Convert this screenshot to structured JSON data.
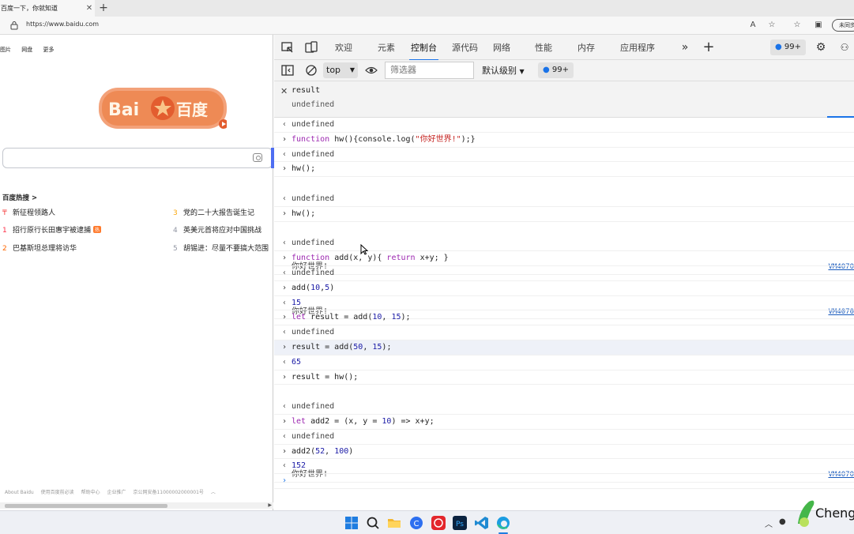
{
  "browser": {
    "tab_title": "百度一下，你就知道",
    "tab_close": "✕",
    "new_tab": "+",
    "url": "https://www.baidu.com",
    "profile": "未同步"
  },
  "baidu": {
    "nav": [
      "图片",
      "网盘",
      "更多"
    ],
    "logo_text": "百度",
    "logo_prefix": "Bai",
    "hot_title": "百度热搜 >",
    "hot_list": [
      {
        "num": "",
        "text": "新征程领路人"
      },
      {
        "num": "1",
        "text": "招行原行长田惠宇被逮捕",
        "badge": "热"
      },
      {
        "num": "2",
        "text": "巴基斯坦总理将访华"
      },
      {
        "num": "3",
        "text": "党的二十大报告诞生记"
      },
      {
        "num": "4",
        "text": "英美元首将应对中国挑战"
      },
      {
        "num": "5",
        "text": "胡锡进：尽量不要搞大范围"
      }
    ],
    "footer": [
      "About Baidu",
      "使用百度前必读",
      "帮助中心",
      "企业推广",
      "京公网安备11000002000001号"
    ]
  },
  "devtools": {
    "tabs": [
      "欢迎",
      "元素",
      "控制台",
      "源代码",
      "网络",
      "性能",
      "内存",
      "应用程序"
    ],
    "active_tab": "控制台",
    "message_count": "99+",
    "context": "top",
    "filter_placeholder": "筛选器",
    "level": "默认级别",
    "live_expression": {
      "expr": "result",
      "value": "undefined"
    },
    "source_link": "VM4070"
  },
  "console": [
    {
      "type": "res",
      "text": "undefined"
    },
    {
      "type": "in",
      "parts": [
        {
          "t": "function",
          "c": "kw"
        },
        {
          "t": " hw(){console.log("
        },
        {
          "t": "\"你好世界!\"",
          "c": "str"
        },
        {
          "t": ");}"
        }
      ]
    },
    {
      "type": "res",
      "text": "undefined"
    },
    {
      "type": "in",
      "text": "hw();"
    },
    {
      "type": "log",
      "text": "你好世界!",
      "src": true
    },
    {
      "type": "res",
      "text": "undefined"
    },
    {
      "type": "in",
      "text": "hw();"
    },
    {
      "type": "log",
      "text": "你好世界!",
      "src": true
    },
    {
      "type": "res",
      "text": "undefined"
    },
    {
      "type": "in",
      "parts": [
        {
          "t": "function",
          "c": "kw"
        },
        {
          "t": " add(x, y){ "
        },
        {
          "t": "return",
          "c": "kw"
        },
        {
          "t": " x+y; }"
        }
      ]
    },
    {
      "type": "res",
      "text": "undefined"
    },
    {
      "type": "in",
      "parts": [
        {
          "t": "add("
        },
        {
          "t": "10",
          "c": "num"
        },
        {
          "t": ","
        },
        {
          "t": "5",
          "c": "num"
        },
        {
          "t": ")"
        }
      ]
    },
    {
      "type": "res",
      "parts": [
        {
          "t": "15",
          "c": "num"
        }
      ]
    },
    {
      "type": "in",
      "parts": [
        {
          "t": "let",
          "c": "kw"
        },
        {
          "t": " result = add("
        },
        {
          "t": "10",
          "c": "num"
        },
        {
          "t": ", "
        },
        {
          "t": "15",
          "c": "num"
        },
        {
          "t": ");"
        }
      ]
    },
    {
      "type": "res",
      "text": "undefined"
    },
    {
      "type": "in",
      "hl": true,
      "parts": [
        {
          "t": "result = add("
        },
        {
          "t": "50",
          "c": "num"
        },
        {
          "t": ", "
        },
        {
          "t": "15",
          "c": "num"
        },
        {
          "t": ");"
        }
      ]
    },
    {
      "type": "res",
      "parts": [
        {
          "t": "65",
          "c": "num"
        }
      ]
    },
    {
      "type": "in",
      "text": "result = hw();"
    },
    {
      "type": "log",
      "text": "你好世界!",
      "src": true
    },
    {
      "type": "res",
      "text": "undefined"
    },
    {
      "type": "in",
      "parts": [
        {
          "t": "let",
          "c": "kw"
        },
        {
          "t": " add2 = (x, y = "
        },
        {
          "t": "10",
          "c": "num"
        },
        {
          "t": ") => x+y;"
        }
      ]
    },
    {
      "type": "res",
      "text": "undefined"
    },
    {
      "type": "in",
      "parts": [
        {
          "t": "add2("
        },
        {
          "t": "52",
          "c": "num"
        },
        {
          "t": ", "
        },
        {
          "t": "100",
          "c": "num"
        },
        {
          "t": ")"
        }
      ]
    },
    {
      "type": "res",
      "parts": [
        {
          "t": "152",
          "c": "num"
        }
      ]
    },
    {
      "type": "prompt",
      "text": ""
    }
  ],
  "brand_text": "Cheng"
}
